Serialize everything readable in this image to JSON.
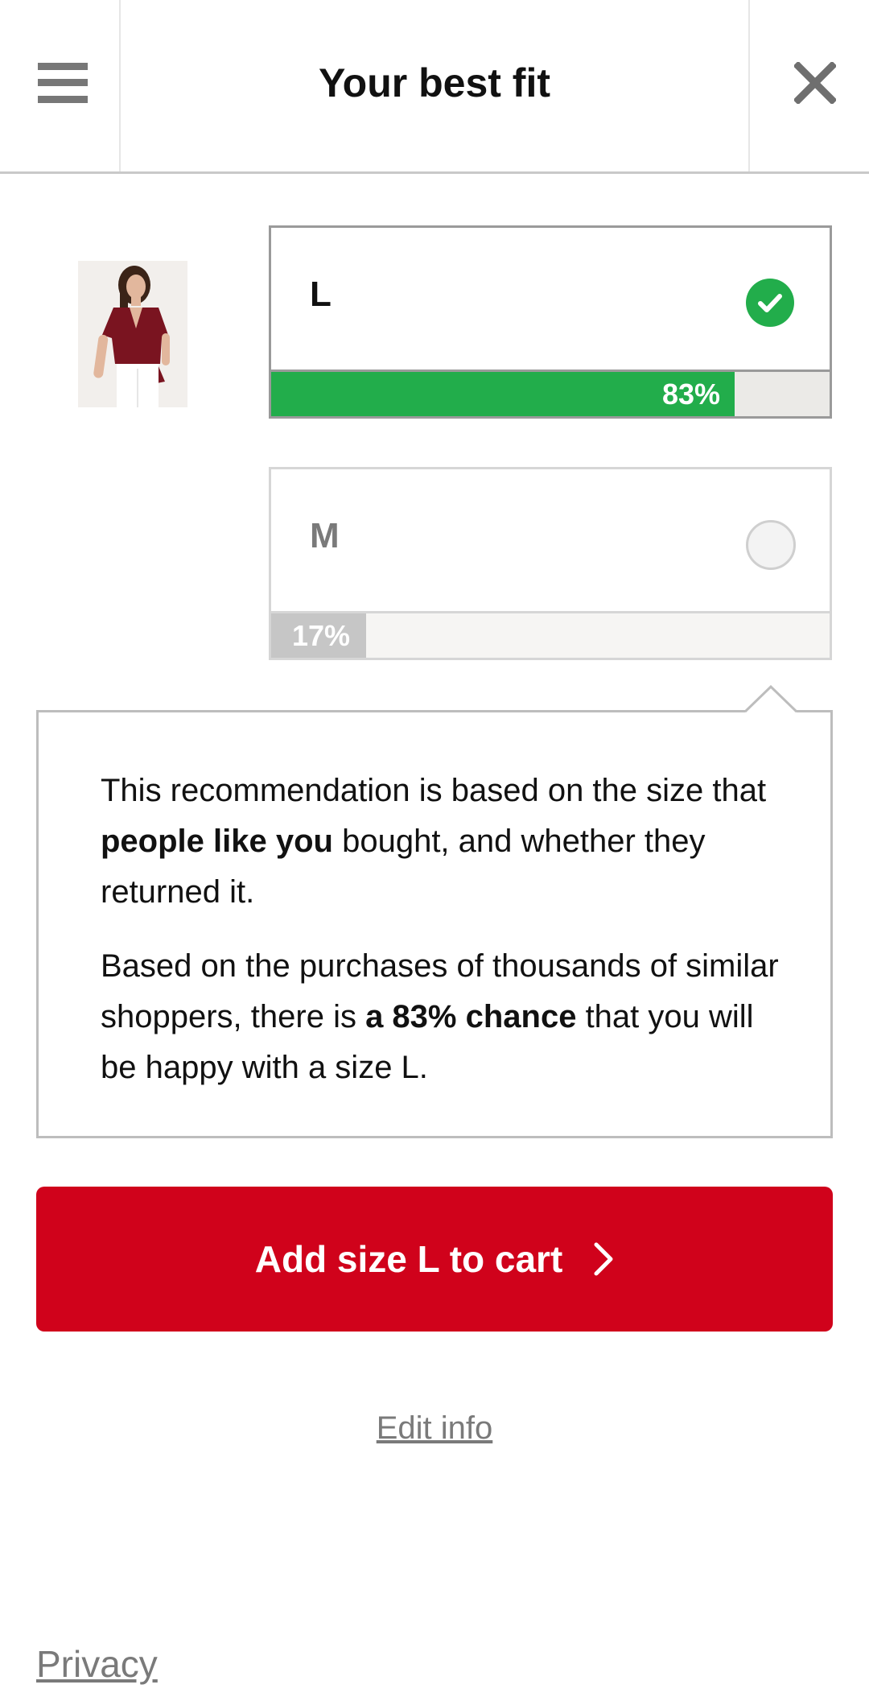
{
  "header": {
    "title": "Your best fit",
    "menu_icon": "hamburger-menu-icon",
    "close_icon": "close-icon"
  },
  "product": {
    "image_icon": "product-thumbnail"
  },
  "sizes": [
    {
      "label": "L",
      "percent_text": "83%",
      "percent": 83,
      "selected": true
    },
    {
      "label": "M",
      "percent_text": "17%",
      "percent": 17,
      "selected": false
    }
  ],
  "explanation": {
    "p1_before": "This recommendation is based on the size that ",
    "p1_bold": "people like you",
    "p1_after": " bought, and whether they returned it.",
    "p2_before": "Based on the purchases of thousands of similar shoppers, there is ",
    "p2_bold": "a 83% chance",
    "p2_after": " that you will be happy with a size L."
  },
  "actions": {
    "add_to_cart_label": "Add size L to cart",
    "edit_info_label": "Edit info",
    "privacy_label": "Privacy"
  },
  "colors": {
    "accent_red": "#d0021b",
    "success_green": "#22ad4b",
    "muted_gray": "#7a7a7a"
  }
}
